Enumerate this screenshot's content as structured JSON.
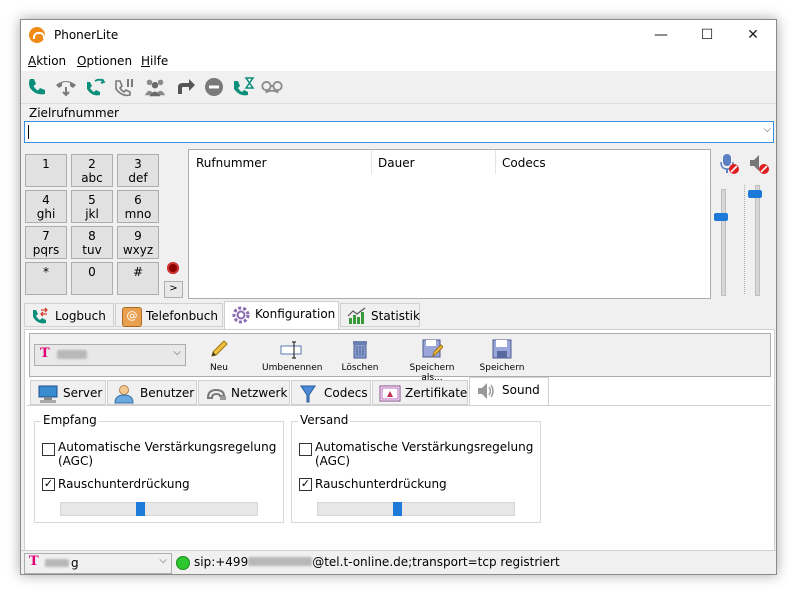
{
  "window": {
    "title": "PhonerLite",
    "minimize": "—",
    "maximize": "☐",
    "close": "✕"
  },
  "menu": {
    "items": [
      {
        "first": "A",
        "rest": "ktion"
      },
      {
        "first": "O",
        "rest": "ptionen"
      },
      {
        "first": "H",
        "rest": "ilfe"
      }
    ]
  },
  "toolbar": {
    "icons": [
      "call-icon",
      "hold-icon",
      "transfer-icon",
      "park-icon",
      "conference-icon",
      "forward-icon",
      "dnd-icon",
      "waiting-icon",
      "anonymous-icon"
    ],
    "colors": {
      "accent": "#0a8f7a",
      "gray": "#7a7a7a"
    }
  },
  "target": {
    "label": "Zielrufnummer",
    "value": "",
    "dropdown": "⌵"
  },
  "keypad": {
    "keys": [
      {
        "main": "1",
        "sub": ""
      },
      {
        "main": "2",
        "sub": "abc"
      },
      {
        "main": "3",
        "sub": "def"
      },
      {
        "main": "4",
        "sub": "ghi"
      },
      {
        "main": "5",
        "sub": "jkl"
      },
      {
        "main": "6",
        "sub": "mno"
      },
      {
        "main": "7",
        "sub": "pqrs"
      },
      {
        "main": "8",
        "sub": "tuv"
      },
      {
        "main": "9",
        "sub": "wxyz"
      },
      {
        "main": "*",
        "sub": ""
      },
      {
        "main": "0",
        "sub": ""
      },
      {
        "main": "#",
        "sub": ""
      }
    ],
    "more": ">"
  },
  "calls": {
    "columns": [
      "Rufnummer",
      "Dauer",
      "Codecs"
    ],
    "rows": []
  },
  "audio": {
    "mic_level": 0.75,
    "speaker_level": 0.95
  },
  "main_tabs": [
    {
      "label": "Logbuch",
      "icon": "logbook-icon"
    },
    {
      "label": "Telefonbuch",
      "icon": "phonebook-icon"
    },
    {
      "label": "Konfiguration",
      "icon": "config-gear-icon"
    },
    {
      "label": "Statistik",
      "icon": "statistics-icon"
    }
  ],
  "config_toolbar": {
    "account_prefix": "T",
    "dropdown": "⌵",
    "buttons": [
      {
        "label": "Neu",
        "icon": "new-pencil-icon"
      },
      {
        "label": "Umbenennen",
        "icon": "rename-icon"
      },
      {
        "label": "Löschen",
        "icon": "delete-trash-icon"
      },
      {
        "label": "Speichern als...",
        "icon": "save-as-icon"
      },
      {
        "label": "Speichern",
        "icon": "save-icon"
      }
    ]
  },
  "config_tabs": [
    {
      "label": "Server",
      "icon": "server-icon"
    },
    {
      "label": "Benutzer",
      "icon": "user-icon"
    },
    {
      "label": "Netzwerk",
      "icon": "network-icon"
    },
    {
      "label": "Codecs",
      "icon": "codecs-icon"
    },
    {
      "label": "Zertifikate",
      "icon": "certificate-icon"
    },
    {
      "label": "Sound",
      "icon": "sound-icon"
    }
  ],
  "sound": {
    "receive": {
      "title": "Empfang",
      "agc_label": "Automatische Verstärkungsregelung (AGC)",
      "agc_checked": false,
      "nr_label": "Rauschunterdrückung",
      "nr_checked": true,
      "level": 0.4
    },
    "send": {
      "title": "Versand",
      "agc_label": "Automatische Verstärkungsregelung (AGC)",
      "agc_checked": false,
      "nr_label": "Rauschunterdrückung",
      "nr_checked": true,
      "level": 0.4
    }
  },
  "status": {
    "account_prefix": "T",
    "account_suffix": "g",
    "dropdown": "⌵",
    "text_start": "sip:+499",
    "text_end": "@tel.t-online.de;transport=tcp registriert",
    "led_color": "#2ec82e"
  }
}
